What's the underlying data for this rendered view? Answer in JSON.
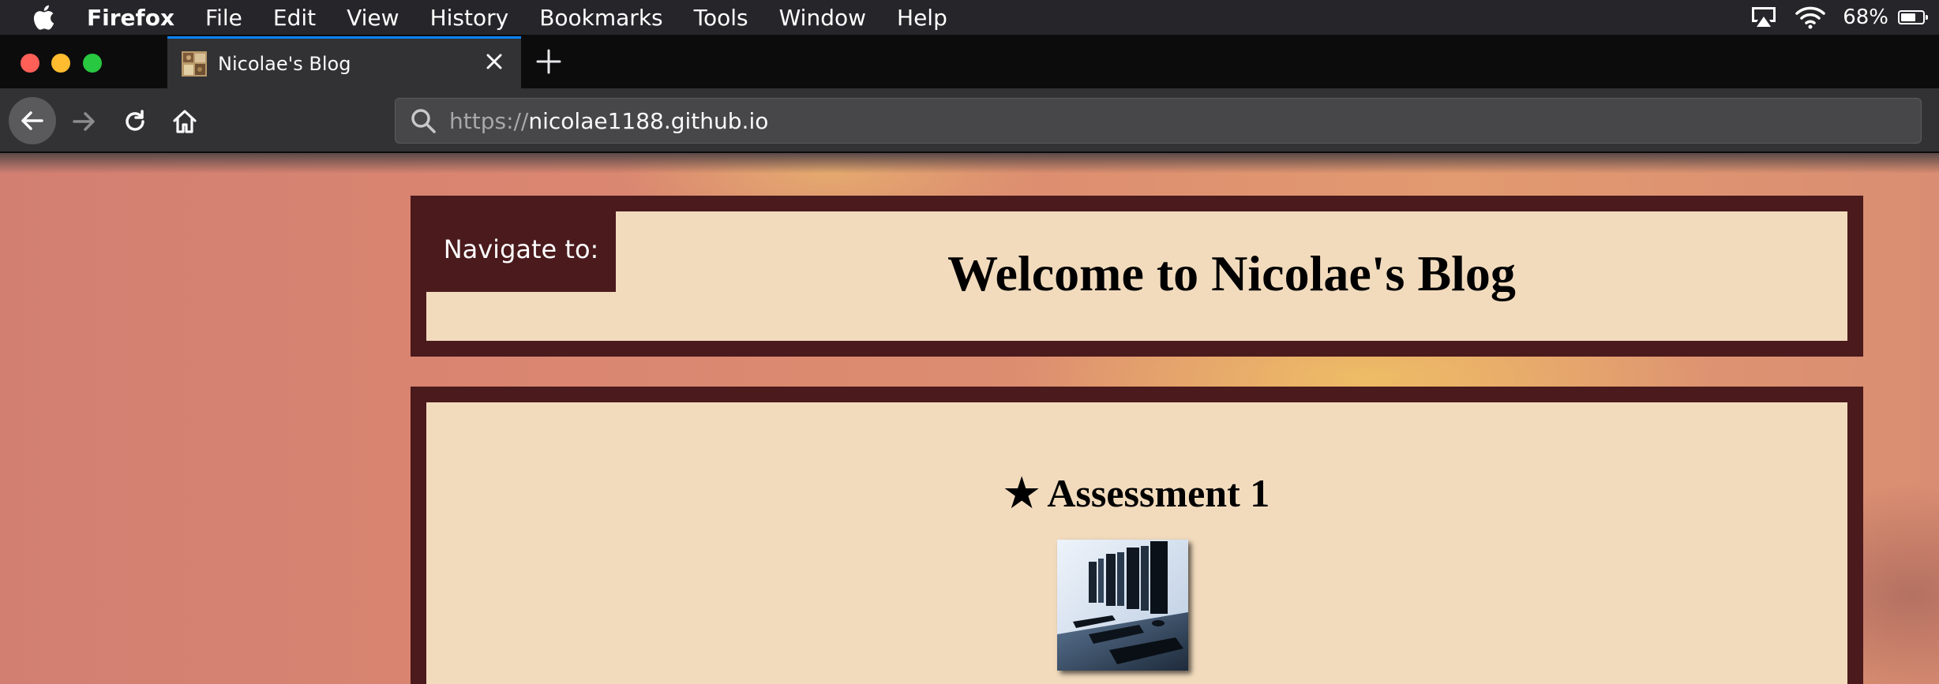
{
  "menubar": {
    "app_name": "Firefox",
    "items": [
      "File",
      "Edit",
      "View",
      "History",
      "Bookmarks",
      "Tools",
      "Window",
      "Help"
    ],
    "battery_percent": "68%",
    "battery_level": 0.68
  },
  "tab": {
    "title": "Nicolae's Blog"
  },
  "toolbar": {
    "url_scheme": "https://",
    "url_host": "nicolae1188.github.io"
  },
  "page": {
    "nav_label": "Navigate to:",
    "site_title": "Welcome to Nicolae's Blog",
    "post_title": "★ Assessment 1"
  },
  "colors": {
    "panel_border": "#4a1a1c",
    "panel_fill": "#f2dbbd",
    "tab_accent": "#0a84ff"
  }
}
